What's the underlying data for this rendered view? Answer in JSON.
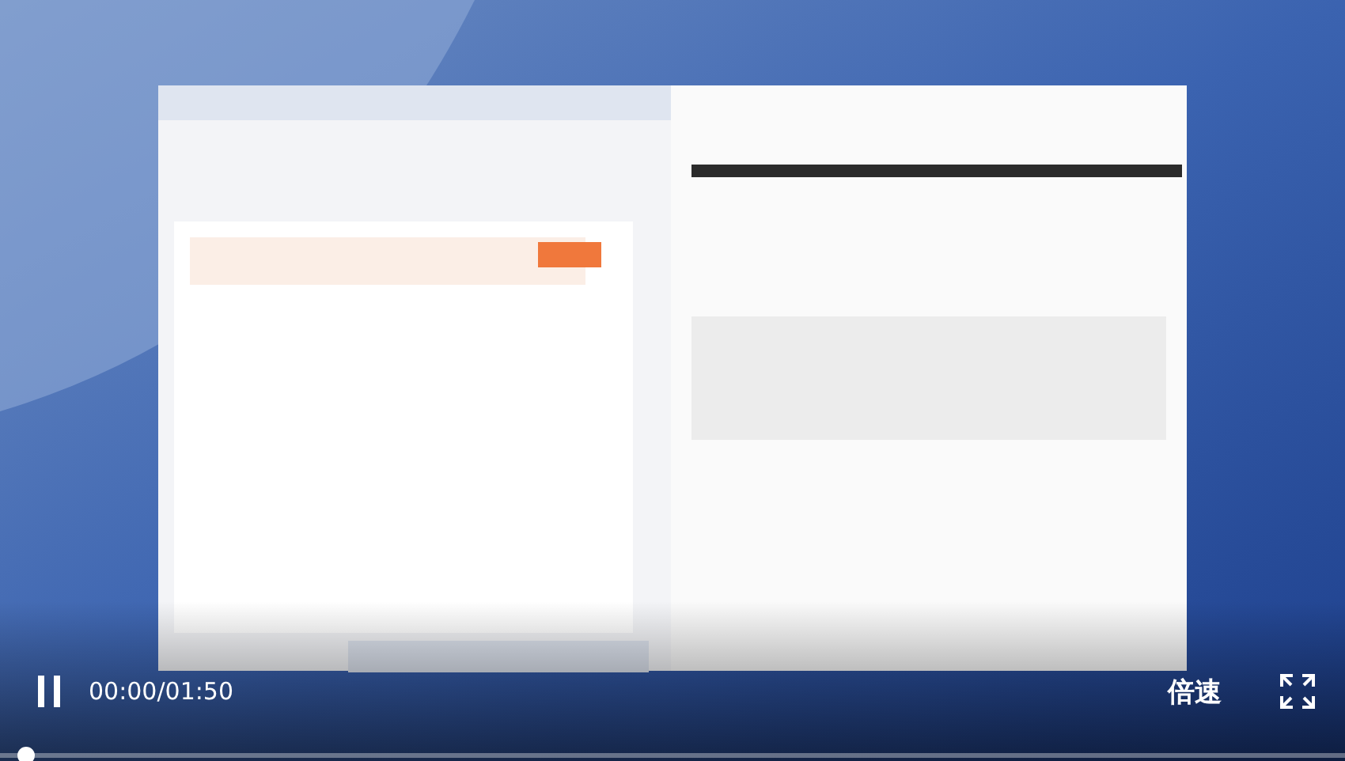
{
  "player": {
    "playing": true,
    "time": "00:00/01:50",
    "speed_label": "倍速",
    "progress": {
      "level": 0
    }
  }
}
